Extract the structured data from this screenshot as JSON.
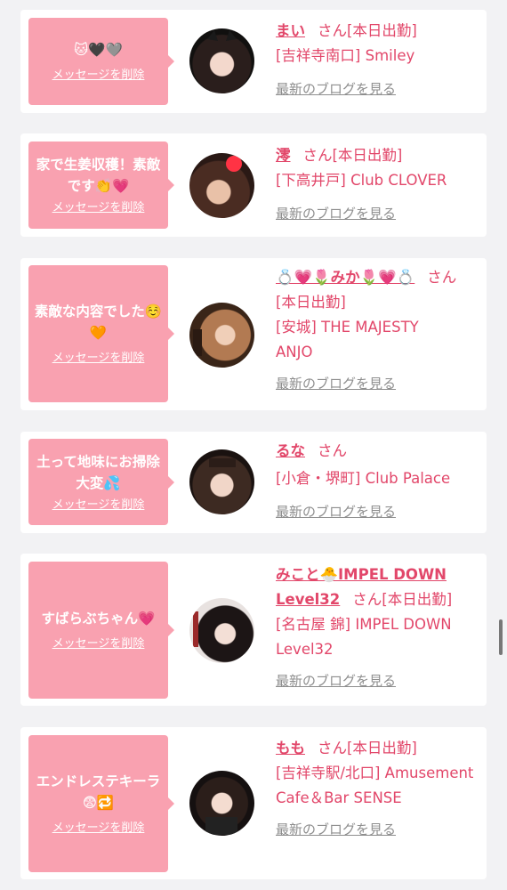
{
  "items": [
    {
      "message": "🐱🖤🩶",
      "delete_label": "メッセージを削除",
      "name": "まい",
      "san": "さん",
      "status": "[本日出勤]",
      "shop": "[吉祥寺南口] Smiley",
      "blog_label": "最新のブログを見る",
      "avatar_icon": "girl-avatar"
    },
    {
      "message": "家で生姜収穫！素敵です👏💗",
      "delete_label": "メッセージを削除",
      "name": "澪",
      "san": "さん",
      "status": "[本日出勤]",
      "shop": "[下高井戸] Club CLOVER",
      "blog_label": "最新のブログを見る",
      "avatar_icon": "girl-avatar"
    },
    {
      "message": "素敵な内容でした☺️🧡",
      "delete_label": "メッセージを削除",
      "name": "💍💗🌷みか🌷💗💍",
      "san": "さん",
      "status": "[本日出勤]",
      "shop": "[安城] THE MAJESTY ANJO",
      "blog_label": "最新のブログを見る",
      "avatar_icon": "girl-avatar"
    },
    {
      "message": "土って地味にお掃除大変💦",
      "delete_label": "メッセージを削除",
      "name": "るな",
      "san": "さん",
      "status": "",
      "shop": "[小倉・堺町] Club Palace",
      "blog_label": "最新のブログを見る",
      "avatar_icon": "girl-avatar"
    },
    {
      "message": "すばらぶちゃん💗",
      "delete_label": "メッセージを削除",
      "name": "みこと🐣IMPEL DOWN Level32",
      "san": "さん",
      "status": "[本日出勤]",
      "shop": "[名古屋 錦] IMPEL DOWN Level32",
      "blog_label": "最新のブログを見る",
      "avatar_icon": "girl-avatar"
    },
    {
      "message": "エンドレステキーラ😨🔁",
      "delete_label": "メッセージを削除",
      "name": "もも",
      "san": "さん",
      "status": "[本日出勤]",
      "shop": "[吉祥寺駅/北口] Amusement Cafe＆Bar SENSE",
      "blog_label": "最新のブログを見る",
      "avatar_icon": "girl-avatar"
    }
  ],
  "colors": {
    "accent": "#e2476a",
    "bubble": "#f9a1b0",
    "link_gray": "#8e8e8e",
    "background": "#f2f2f4"
  }
}
